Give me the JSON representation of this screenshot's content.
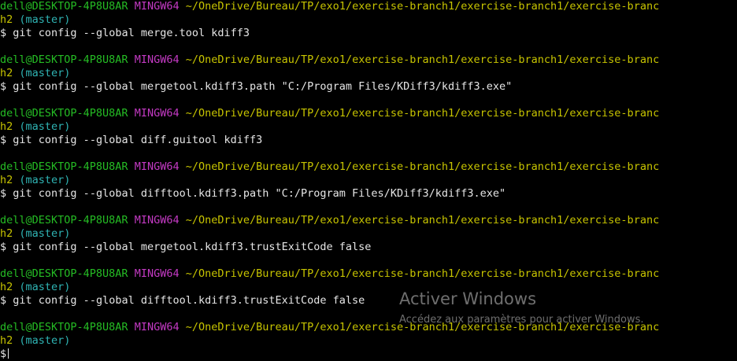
{
  "terminal": {
    "prompt_user": "dell@DESKTOP-4P8U8AR",
    "prompt_system": "MINGW64",
    "path_line1": "~/OneDrive/Bureau/TP/exo1/exercise-branch1/exercise-branch1/exercise-branc",
    "path_line2": "h2",
    "branch": "(master)",
    "dollar": "$",
    "commands": [
      "git config --global merge.tool kdiff3",
      "git config --global mergetool.kdiff3.path \"C:/Program Files/KDiff3/kdiff3.exe\"",
      "git config --global diff.guitool kdiff3",
      "git config --global difftool.kdiff3.path \"C:/Program Files/KDiff3/kdiff3.exe\"",
      "git config --global mergetool.kdiff3.trustExitCode false",
      "git config --global difftool.kdiff3.trustExitCode false"
    ]
  },
  "watermark": {
    "title": "Activer Windows",
    "subtitle": "Accédez aux paramètres pour activer Windows."
  },
  "colors": {
    "background": "#000000",
    "user": "#25bc24",
    "system": "#c43ac4",
    "path": "#c7c400",
    "branch": "#2fb4b4",
    "text": "#e6e6e6"
  }
}
